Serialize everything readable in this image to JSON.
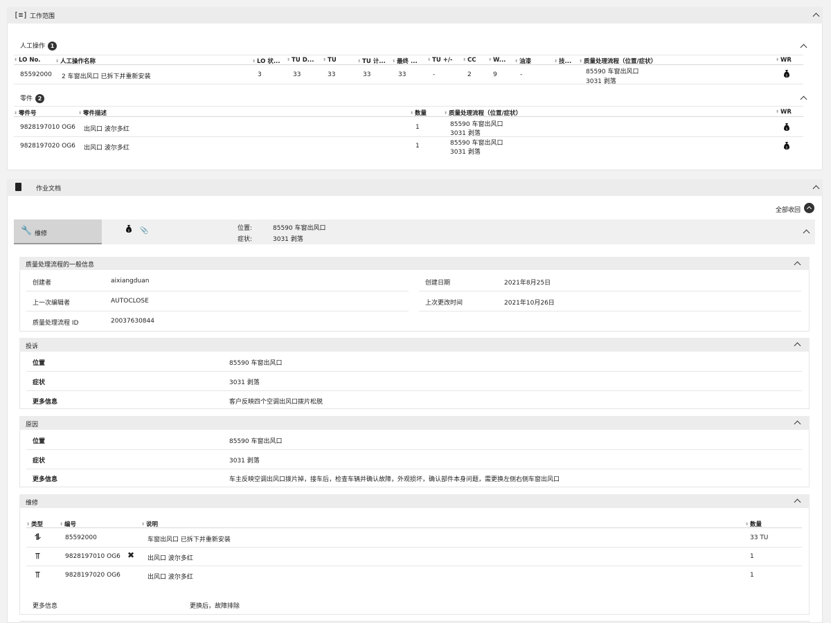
{
  "scope": {
    "title": "工作范围",
    "labor": {
      "title": "人工操作",
      "count": "1",
      "headers": [
        "LO No.",
        "人工操作名称",
        "LO 状...",
        "TU D...",
        "TU",
        "TU 计...",
        "最终 ...",
        "TU +/-",
        "CC",
        "W...",
        "油漆",
        "技...",
        "质量处理流程（位置/症状）",
        "WR"
      ],
      "row": {
        "lo_no": "85592000",
        "name": "2 车窗出风口 已拆下并重新安装",
        "status": "3",
        "tu_d": "33",
        "tu": "33",
        "tu_calc": "33",
        "final": "33",
        "tu_pm": "-",
        "cc": "2",
        "w": "9",
        "paint": "-",
        "qm_line1": "85590 车窗出风口",
        "qm_line2": "3031 剥落"
      }
    },
    "parts": {
      "title": "零件",
      "count": "2",
      "headers": [
        "零件号",
        "零件描述",
        "数量",
        "质量处理流程（位置/症状）",
        "WR"
      ],
      "rows": [
        {
          "no": "9828197010 OG6",
          "desc": "出风口 波尔多红",
          "qty": "1",
          "qm1": "85590 车窗出风口",
          "qm2": "3031 剥落"
        },
        {
          "no": "9828197020 OG6",
          "desc": "出风口 波尔多红",
          "qty": "1",
          "qm1": "85590 车窗出风口",
          "qm2": "3031 剥落"
        }
      ]
    }
  },
  "docs": {
    "title": "作业文档",
    "collapse_all": "全部收回",
    "tab_label": "维修",
    "pos_label": "位置:",
    "pos_value": "85590 车窗出风口",
    "sym_label": "症状:",
    "sym_value": "3031 剥落",
    "general": {
      "title": "质量处理流程的一般信息",
      "creator_label": "创建者",
      "creator": "aixiangduan",
      "editor_label": "上一次编辑者",
      "editor": "AUTOCLOSE",
      "id_label": "质量处理流程 ID",
      "id": "20037630844",
      "created_label": "创建日期",
      "created": "2021年8月25日",
      "changed_label": "上次更改时间",
      "changed": "2021年10月26日"
    },
    "complaint": {
      "title": "投诉",
      "rows": [
        {
          "label": "位置",
          "value": "85590 车窗出风口"
        },
        {
          "label": "症状",
          "value": "3031 剥落"
        },
        {
          "label": "更多信息",
          "value": "客户反映四个空调出风口拨片松脱"
        }
      ]
    },
    "cause": {
      "title": "原因",
      "rows": [
        {
          "label": "位置",
          "value": "85590 车窗出风口"
        },
        {
          "label": "症状",
          "value": "3031 剥落"
        },
        {
          "label": "更多信息",
          "value": "车主反映空调出风口拨片掉，接车后，检查车辆并确认故障，外观损坏，确认部件本身问题，需更换左侧右侧车窗出风口"
        }
      ]
    },
    "repair": {
      "title": "维修",
      "headers": [
        "类型",
        "编号",
        "说明",
        "数量"
      ],
      "rows": [
        {
          "no": "85592000",
          "desc": "车窗出风口 已拆下并重新安装",
          "qty": "33 TU"
        },
        {
          "no": "9828197010 OG6",
          "desc": "出风口 波尔多红",
          "qty": "1"
        },
        {
          "no": "9828197020 OG6",
          "desc": "出风口 波尔多红",
          "qty": "1"
        }
      ],
      "more_label": "更多信息",
      "more_value": "更换后，故障排除"
    }
  }
}
